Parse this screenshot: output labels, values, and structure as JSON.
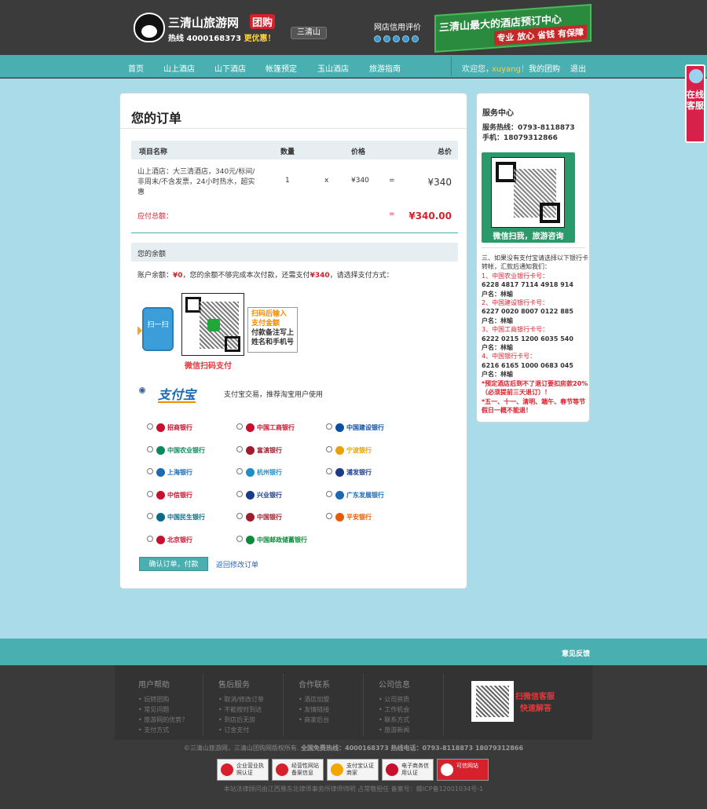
{
  "header": {
    "site_name": "三清山旅游网",
    "group_label": "团购",
    "hotline_prefix": "热线",
    "hotline": "4000168373",
    "hotline_suffix": "更优惠！",
    "location_tag": "三清山",
    "credit_label": "网店信用评价",
    "banner_line1": "三清山最大的酒店预订中心",
    "banner_line2": "专业 放心 省钱 有保障"
  },
  "nav": {
    "items": [
      "首页",
      "山上酒店",
      "山下酒店",
      "帐篷预定",
      "玉山酒店",
      "旅游指南"
    ],
    "welcome": "欢迎您，",
    "username": "xuyang！",
    "my_orders": "我的团购",
    "logout": "退出"
  },
  "order": {
    "title": "您的订单",
    "col_name": "项目名称",
    "col_qty": "数量",
    "col_price": "价格",
    "col_total": "总价",
    "item_desc": "山上酒店：大三清酒店，340元/标间/非周末/不含发票，24小时热水，超实惠",
    "item_qty": "1",
    "times": "x",
    "item_price": "¥340",
    "equals": "=",
    "item_total": "¥340",
    "due_label": "应付总额：",
    "due_equals": "=",
    "due_total": "¥340.00"
  },
  "balance": {
    "heading": "您的余额",
    "text_prefix": "账户余额：",
    "amount": "¥0",
    "text_mid": "，您的余额不够完成本次付款，还需支付",
    "need": "¥340",
    "text_suffix": "，请选择支付方式："
  },
  "wechat_pay": {
    "phone_text": "扫一扫",
    "box_line1": "扫码后输入",
    "box_line2": "支付金额",
    "box_line3": "付款备注写上",
    "box_line4": "姓名和手机号",
    "label": "微信扫码支付"
  },
  "alipay": {
    "logo": "支付宝",
    "note": "支付宝交易，推荐淘宝用户使用"
  },
  "banks": [
    {
      "name": "招商银行",
      "color": "#c8102e"
    },
    {
      "name": "中国工商银行",
      "color": "#c8102e"
    },
    {
      "name": "中国建设银行",
      "color": "#0b4fa2"
    },
    {
      "name": "中国农业银行",
      "color": "#0a8a5a"
    },
    {
      "name": "富滇银行",
      "color": "#a01c2c"
    },
    {
      "name": "宁波银行",
      "color": "#e8a100"
    },
    {
      "name": "上海银行",
      "color": "#1a6ab4"
    },
    {
      "name": "杭州银行",
      "color": "#1a8fc8"
    },
    {
      "name": "浦发银行",
      "color": "#1a3a8a"
    },
    {
      "name": "中信银行",
      "color": "#c8102e"
    },
    {
      "name": "兴业银行",
      "color": "#1a3a8a"
    },
    {
      "name": "广东发展银行",
      "color": "#1a6ab4"
    },
    {
      "name": "中国民生银行",
      "color": "#0a6a8a"
    },
    {
      "name": "中国银行",
      "color": "#a01c2c"
    },
    {
      "name": "平安银行",
      "color": "#e85a00"
    },
    {
      "name": "北京银行",
      "color": "#c8102e"
    },
    {
      "name": "中国邮政储蓄银行",
      "color": "#0a8a3a"
    }
  ],
  "actions": {
    "confirm": "确认订单，付款",
    "back": "返回修改订单"
  },
  "service": {
    "title": "服务中心",
    "hotline": "服务热线：0793-8118873",
    "mobile": "手机：18079312866",
    "qr_caption": "微信扫我，旅游咨询",
    "intro": "三、如果没有支付宝请选择以下银行卡转帐，汇款后通知我们：",
    "accounts": [
      {
        "bank": "1、中国农业银行卡号：",
        "number": "6228 4817 7114 4918 914",
        "holder": "户名：林瑜"
      },
      {
        "bank": "2、中国建设银行卡号：",
        "number": "6227 0020 8007 0122 885",
        "holder": "户名：林瑜"
      },
      {
        "bank": "3、中国工商银行卡号：",
        "number": "6222 0215 1200 6035 540",
        "holder": "户名：林瑜"
      },
      {
        "bank": "4、中国银行卡号：",
        "number": "6216 6165 1000 0683 045",
        "holder": "户名：林瑜"
      }
    ],
    "notice1": "*预定酒店后到不了退订要扣房款20%（必须提前三天退订）！",
    "notice2": "*五一、十一、清明、端午、春节等节假日一概不能退！"
  },
  "kefu": {
    "label": "在线客服"
  },
  "footer": {
    "feedback": "意见反馈",
    "columns": [
      {
        "title": "用户帮助",
        "items": [
          "玩转团购",
          "常见问题",
          "旅游网的优势？",
          "支付方式"
        ]
      },
      {
        "title": "售后服务",
        "items": [
          "取消/修改订单",
          "不能按时到达",
          "到店后无房",
          "订金支付"
        ]
      },
      {
        "title": "合作联系",
        "items": [
          "酒店加盟",
          "友情链接",
          "商家后台"
        ]
      },
      {
        "title": "公司信息",
        "items": [
          "公司资质",
          "工作机会",
          "联系方式",
          "旅游新闻"
        ]
      }
    ],
    "qr_text1": "扫微信客服",
    "qr_text2": "快速解答",
    "copyright": "©三清山旅游网，三清山团购网版权所有.",
    "copyright_hot": "全国免费热线：4000168373  热线电话：0793-8118873  18079312866",
    "badges": [
      "企业营业执照认证",
      "经营性网站备案信息",
      "支付宝认证商家",
      "电子商务信用认证",
      "可信网站"
    ],
    "icp": "本站法律顾问由江西豫东北律师事务所律师帅明 占常敬担任 备案号：赣ICP备12001034号-1"
  }
}
